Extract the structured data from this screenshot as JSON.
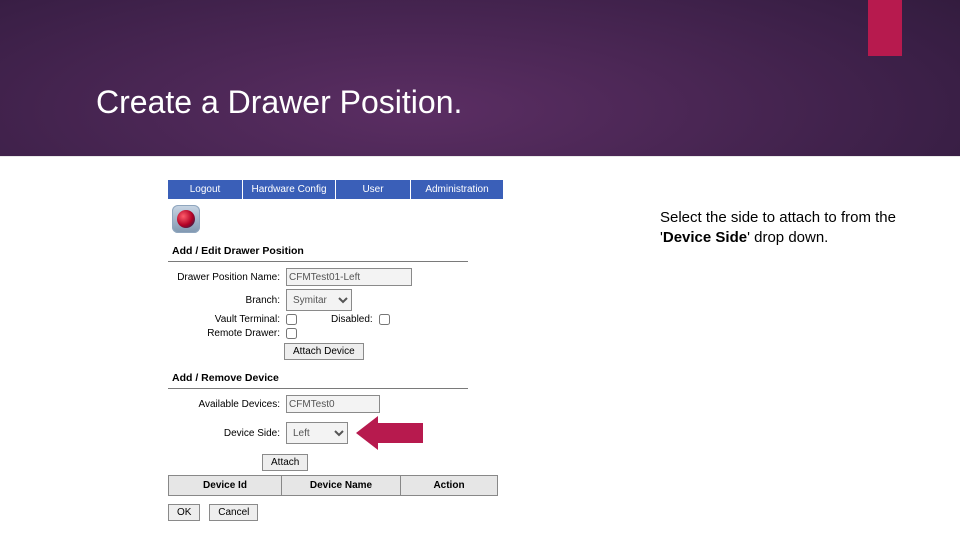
{
  "slide": {
    "title": "Create a Drawer Position."
  },
  "annotation": {
    "prefix": "Select the side to attach to from the '",
    "bold": "Device Side",
    "suffix": "' drop down."
  },
  "nav": {
    "logout": "Logout",
    "hardware": "Hardware Config",
    "user": "User",
    "admin": "Administration"
  },
  "sections": {
    "addEdit": "Add / Edit Drawer Position",
    "addRemove": "Add / Remove Device"
  },
  "form": {
    "posNameLabel": "Drawer Position Name:",
    "posNameValue": "CFMTest01-Left",
    "branchLabel": "Branch:",
    "branchValue": "Symitar",
    "vaultLabel": "Vault Terminal:",
    "disabledLabel": "Disabled:",
    "remoteLabel": "Remote Drawer:",
    "attachDeviceBtn": "Attach Device",
    "availLabel": "Available Devices:",
    "availValue": "CFMTest0",
    "sideLabel": "Device Side:",
    "sideValue": "Left",
    "attachBtn": "Attach"
  },
  "table": {
    "deviceId": "Device Id",
    "deviceName": "Device Name",
    "action": "Action"
  },
  "buttons": {
    "ok": "OK",
    "cancel": "Cancel"
  }
}
